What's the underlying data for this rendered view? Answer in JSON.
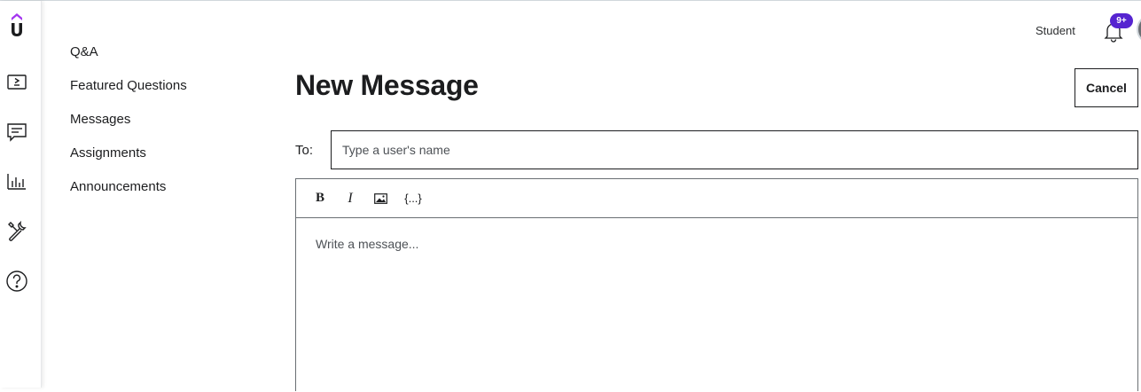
{
  "colors": {
    "brand_purple": "#5624d0",
    "text_dark": "#1c1d1f",
    "border": "#6a6f73"
  },
  "rail": {
    "icons": [
      "udemy-logo-icon",
      "course-video-icon",
      "comment-icon",
      "analytics-icon",
      "tools-icon",
      "help-icon"
    ]
  },
  "subnav": {
    "items": [
      {
        "label": "Q&A"
      },
      {
        "label": "Featured Questions"
      },
      {
        "label": "Messages"
      },
      {
        "label": "Assignments"
      },
      {
        "label": "Announcements"
      }
    ]
  },
  "header": {
    "user_label": "Student",
    "notification_badge": "9+"
  },
  "main": {
    "title": "New Message",
    "cancel_label": "Cancel",
    "to_label": "To:",
    "to_placeholder": "Type a user's name",
    "toolbar": {
      "bold": "B",
      "italic": "I",
      "image_icon": "image-icon",
      "code": "{...}"
    },
    "message_placeholder": "Write a message..."
  }
}
